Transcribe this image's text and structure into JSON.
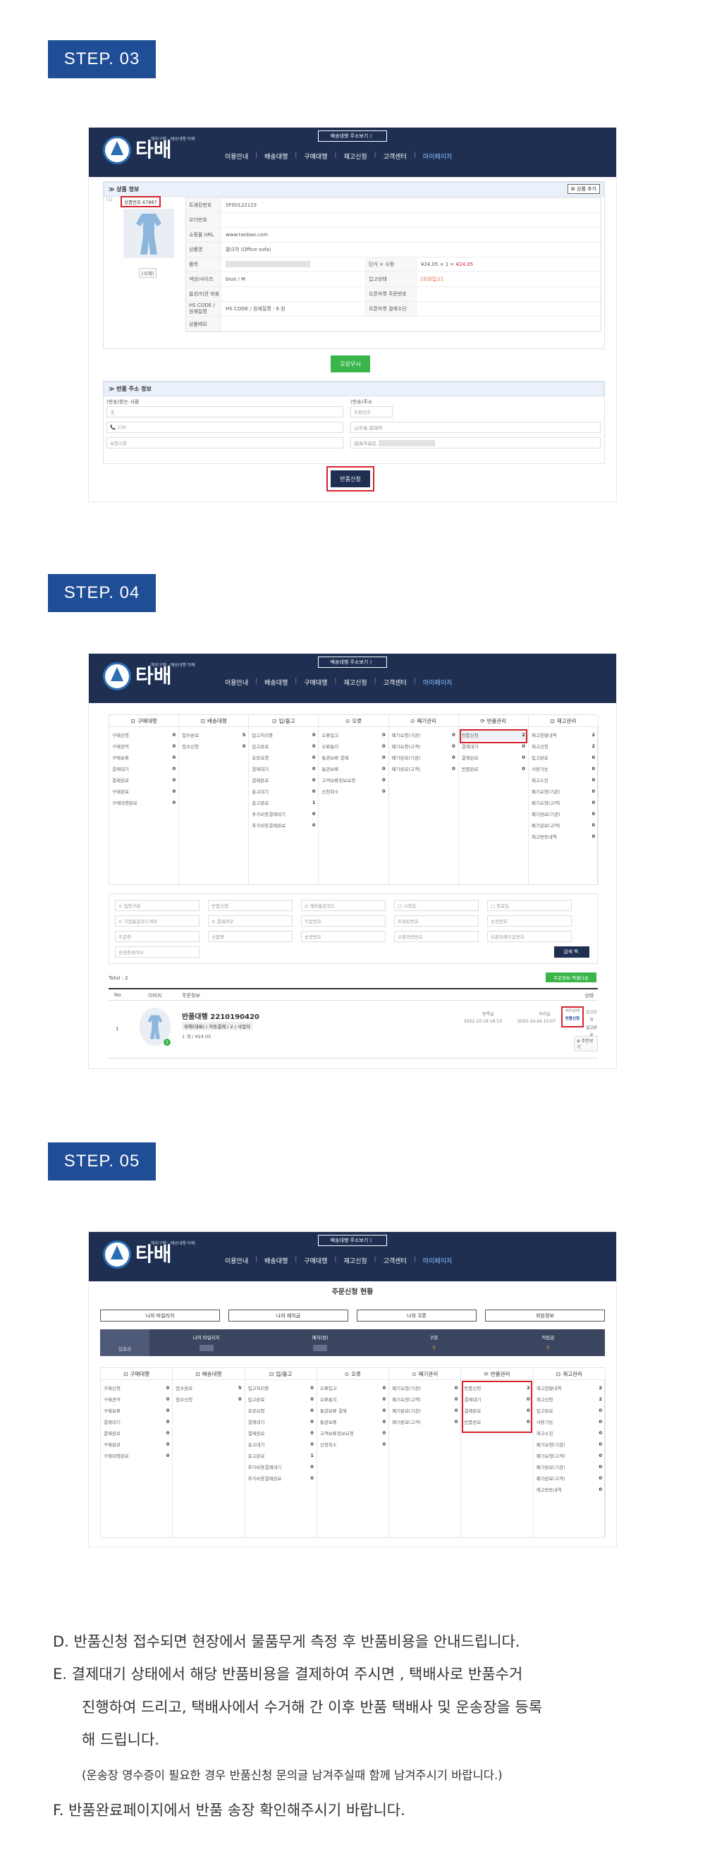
{
  "header": {
    "logo_text": "타배",
    "slogan": "해외구매 · 배송대행 타배",
    "addr_btn": "배송대행 주소보기 〉",
    "nav": [
      "이용안내",
      "배송대행",
      "구매대행",
      "재고신청",
      "고객센터",
      "마이페이지"
    ]
  },
  "steps": [
    "STEP. 03",
    "STEP. 04",
    "STEP. 05"
  ],
  "s3": {
    "section_title": "≫ 상품 정보",
    "add_btn": "⊞ 상품 추가",
    "badge": "상품번호 67887",
    "img_caption": "[이미지]",
    "img_btn": "[삭제]",
    "rows": [
      {
        "l": "트래킹번호",
        "v": "SF00122123"
      },
      {
        "l": "오더번호",
        "v": ""
      },
      {
        "l": "쇼핑몰 URL",
        "v": "www.taobao.com"
      },
      {
        "l": "상품명",
        "v": "황녀각 (Office sofa)"
      },
      {
        "l": "품목",
        "v": ""
      },
      {
        "l": "색상/사이즈",
        "v": "blue / M"
      },
      {
        "l": "옵션/타관 비용",
        "v": ""
      },
      {
        "l": "HS CODE / 원재질명",
        "v": "HS CODE / 원재질명 : 6 원"
      },
      {
        "l": "상품메모",
        "v": ""
      }
    ],
    "right_rows": [
      {
        "l": "단가 × 수량",
        "v": "¥24.05 × 1 = ",
        "v2": "¥24.05"
      },
      {
        "l": "입고상태",
        "v": "[요청입고]"
      },
      {
        "l": "오픈마켓 주문번호",
        "v": ""
      },
      {
        "l": "오픈마켓 결제수단",
        "v": ""
      }
    ],
    "confirm_btn": "오류무시",
    "ret_title": "≫ 반품 주소 정보",
    "from_label": "(반송)받는 사람",
    "to_label": "(반송)주소",
    "name_ph": "王",
    "zip_ph": "우편번호",
    "tel_ph": "130",
    "addr_ph": "山东省 威海市",
    "memo_ph": "요청사항",
    "detail_ph": "威海市高区",
    "submit": "반품신청"
  },
  "s4": {
    "cols": [
      {
        "h": "구매대행",
        "icon": "⊡",
        "items": [
          [
            "구매신청",
            "0"
          ],
          [
            "구매견적",
            "0"
          ],
          [
            "구매보류",
            "0"
          ],
          [
            "결제대기",
            "0"
          ],
          [
            "결제완료",
            "0"
          ],
          [
            "구매완료",
            "0"
          ],
          [
            "구매대행완료",
            "0"
          ]
        ]
      },
      {
        "h": "배송대행",
        "icon": "⊡",
        "items": [
          [
            "접수완료",
            "5"
          ],
          [
            "접수신청",
            "0"
          ]
        ]
      },
      {
        "h": "입/출고",
        "icon": "⊡",
        "items": [
          [
            "입고처리중",
            "0"
          ],
          [
            "입고완료",
            "0"
          ],
          [
            "포장요청",
            "0"
          ],
          [
            "결제대기",
            "0"
          ],
          [
            "결제완료",
            "0"
          ],
          [
            "출고대기",
            "0"
          ],
          [
            "출고완료",
            "1"
          ],
          [
            "추가비용결제대기",
            "0"
          ],
          [
            "추가비용결제완료",
            "0"
          ]
        ]
      },
      {
        "h": "오류",
        "icon": "⊙",
        "items": [
          [
            "오류입고",
            "0"
          ],
          [
            "오류통지",
            "0"
          ],
          [
            "통관보류 결제",
            "0"
          ],
          [
            "통관보류",
            "0"
          ],
          [
            "고객보류정보요청",
            "0"
          ],
          [
            "신청취소",
            "0"
          ]
        ]
      },
      {
        "h": "폐기관리",
        "icon": "⊙",
        "items": [
          [
            "폐기요청(기관)",
            "0"
          ],
          [
            "폐기요청(고객)",
            "0"
          ],
          [
            "폐기완료(기관)",
            "0"
          ],
          [
            "폐기완료(고객)",
            "0"
          ]
        ]
      },
      {
        "h": "반품관리",
        "icon": "⟳",
        "items": [
          [
            "반품신청",
            "2"
          ],
          [
            "결제대기",
            "0"
          ],
          [
            "결제완료",
            "0"
          ],
          [
            "반품완료",
            "0"
          ]
        ]
      },
      {
        "h": "재고관리",
        "icon": "⊡",
        "items": [
          [
            "재고현황내역",
            "2"
          ],
          [
            "재고신청",
            "2"
          ],
          [
            "입고완료",
            "0"
          ],
          [
            "사용가능",
            "0"
          ],
          [
            "재고소진",
            "0"
          ],
          [
            "폐기요청(기관)",
            "0"
          ],
          [
            "폐기요청(고객)",
            "0"
          ],
          [
            "폐기완료(기관)",
            "0"
          ],
          [
            "폐기완료(고객)",
            "0"
          ],
          [
            "재고변동내역",
            "0"
          ]
        ]
      }
    ],
    "filters": [
      "≡ 입청구분",
      "반품신청",
      "≡ 해외통관코드",
      "□ 시작일",
      "□ 종료일",
      "≡ 기업통관코드여부",
      "≡ 결제여부",
      "주문번호",
      "트래킹번호",
      "송장번호",
      "주문명",
      "상품명",
      "송장번호",
      "오픈마켓번호",
      "오픈마켓주문번호",
      "송장등록여부"
    ],
    "search_btn": "검색 🔍",
    "excel_btn": "주문정보 엑셀다운",
    "total": "Total : 2",
    "th": [
      "No",
      "이미지",
      "주문정보",
      "상태"
    ],
    "order": {
      "no": "1",
      "title": "반품대행 2210190420",
      "sub": "위해(대륙) / 자동결제 / 2 / 사업자",
      "price": "1 개 / ¥24.05",
      "reg_label": "등록일",
      "reg": "2022-10-19 16:13",
      "upd_label": "처리일",
      "upd": "2022-10-24 15:07",
      "status_label": "처리상태",
      "status": "반품신청",
      "ship_label": "입고상태",
      "ship": "입고완료",
      "detail": "⊕ 주문보기"
    }
  },
  "s5": {
    "title": "주문신청 현황",
    "btns": [
      "나의 마일리지",
      "나의 예치금",
      "나의 쿠폰",
      "회원정보"
    ],
    "summary": [
      [
        "입출금",
        "나의 마일리지"
      ],
      [
        "0",
        "예치(원)"
      ],
      [
        "0",
        "쿠폰"
      ],
      [
        "0",
        "적립금"
      ]
    ],
    "sum_first": "입출금",
    "sum_labels": [
      "나의 마일리지",
      "예치(원)",
      "쿠폰",
      "적립금"
    ],
    "sum_vals": [
      "",
      "",
      "0",
      "0"
    ]
  },
  "bottom": {
    "d": "D.  반품신청 접수되면 현장에서 물품무게 측정 후 반품비용을 안내드립니다.",
    "e1": "E.  결제대기 상태에서 해당 반품비용을 결제하여 주시면 , 택배사로 반품수거",
    "e2": "진행하여 드리고, 택배사에서 수거해 간 이후 반품 택배사 및 운송장을 등록",
    "e3": "해 드립니다.",
    "e4": "(운송장 영수증이 필요한 경우 반품신청 문의글 남겨주실때 함께 남겨주시기 바랍니다.)",
    "f": "F.  반품완료페이지에서 반품 송장 확인해주시기 바랍니다."
  }
}
